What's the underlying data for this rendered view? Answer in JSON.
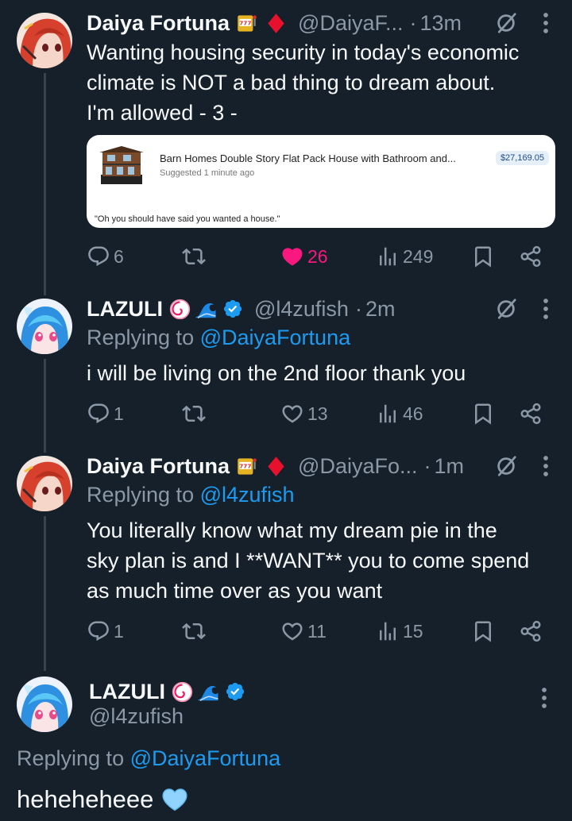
{
  "tweets": [
    {
      "author": {
        "name": "Daiya Fortuna",
        "handle": "@DaiyaF...",
        "emojis": [
          "slot-machine",
          "red-diamond"
        ]
      },
      "time": "13m",
      "text": [
        "Wanting housing security in today's economic",
        "climate is NOT a bad thing to dream about.",
        "I'm allowed - 3 -"
      ],
      "card": {
        "title": "Barn Homes Double Story Flat Pack House with Bathroom and...",
        "subtitle": "Suggested 1 minute ago",
        "price": "$27,169.05",
        "quote": "\"Oh you should have said you wanted a house.\""
      },
      "stats": {
        "replies": "6",
        "likes": "26",
        "views": "249"
      },
      "liked": true
    },
    {
      "author": {
        "name": "LAZULI",
        "handle": "@l4zufish",
        "emojis": [
          "spiral",
          "wave"
        ],
        "verified": true
      },
      "time": "2m",
      "replying_to_label": "Replying to",
      "replying_to": "@DaiyaFortuna",
      "text": [
        "i will be living on the 2nd floor thank you"
      ],
      "stats": {
        "replies": "1",
        "likes": "13",
        "views": "46"
      }
    },
    {
      "author": {
        "name": "Daiya Fortuna",
        "handle": "@DaiyaFo...",
        "emojis": [
          "slot-machine",
          "red-diamond"
        ]
      },
      "time": "1m",
      "replying_to_label": "Replying to",
      "replying_to": "@l4zufish",
      "text": [
        "You literally know what my dream pie in the",
        "sky plan is and I **WANT** you to come spend",
        "as much time over as you want"
      ],
      "stats": {
        "replies": "1",
        "likes": "11",
        "views": "15"
      }
    }
  ],
  "focused": {
    "author": {
      "name": "LAZULI",
      "handle": "@l4zufish",
      "emojis": [
        "spiral",
        "wave"
      ],
      "verified": true
    },
    "replying_to_label": "Replying to",
    "replying_to": "@DaiyaFortuna",
    "text": "heheheheee",
    "emoji": "light-blue-heart"
  },
  "colors": {
    "background": "#15202b",
    "text": "#f7f9f9",
    "muted": "#8b98a5",
    "link": "#1d9bf0",
    "like": "#f91880"
  }
}
